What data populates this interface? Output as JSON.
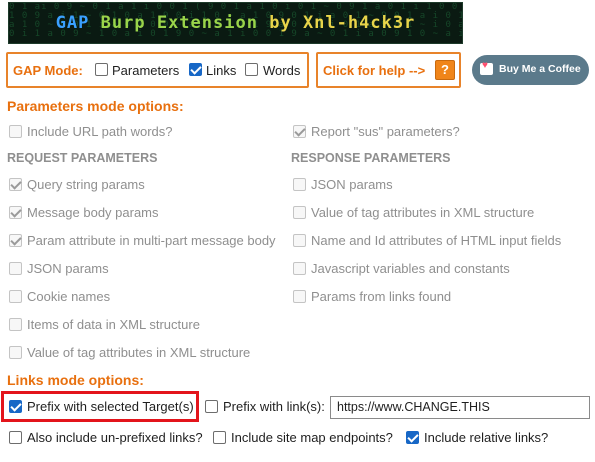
{
  "banner": {
    "title_gap": "GAP",
    "title_mid": "Burp Extension",
    "title_by": "by",
    "title_author": "Xnl-h4ck3r"
  },
  "mode_bar": {
    "label": "GAP Mode:",
    "options": [
      {
        "label": "Parameters",
        "checked": false
      },
      {
        "label": "Links",
        "checked": true
      },
      {
        "label": "Words",
        "checked": false
      }
    ]
  },
  "help": {
    "label": "Click for help -->",
    "button": "?"
  },
  "coffee": {
    "label": "Buy Me a Coffee",
    "icon": "coffee-cup-heart-icon"
  },
  "params_section": {
    "title": "Parameters mode options:",
    "top_left": {
      "label": "Include URL path words?",
      "checked": false
    },
    "top_right": {
      "label": "Report \"sus\" parameters?",
      "checked": true
    },
    "request_title": "REQUEST PARAMETERS",
    "response_title": "RESPONSE PARAMETERS",
    "request": [
      {
        "label": "Query string params",
        "checked": true
      },
      {
        "label": "Message body params",
        "checked": true
      },
      {
        "label": "Param attribute in multi-part message body",
        "checked": true
      },
      {
        "label": "JSON params",
        "checked": false
      },
      {
        "label": "Cookie names",
        "checked": false
      },
      {
        "label": "Items of data in XML structure",
        "checked": false
      },
      {
        "label": "Value of tag attributes in XML structure",
        "checked": false
      }
    ],
    "response": [
      {
        "label": "JSON params",
        "checked": false
      },
      {
        "label": "Value of tag attributes in XML structure",
        "checked": false
      },
      {
        "label": "Name and Id attributes of HTML input fields",
        "checked": false
      },
      {
        "label": "Javascript variables and constants",
        "checked": false
      },
      {
        "label": "Params from links found",
        "checked": false
      }
    ]
  },
  "links_section": {
    "title": "Links mode options:",
    "prefix_target": {
      "label": "Prefix with selected Target(s)",
      "checked": true
    },
    "prefix_link": {
      "label": "Prefix with link(s):",
      "checked": false
    },
    "prefix_url_value": "https://www.CHANGE.THIS",
    "unprefixed": {
      "label": "Also include un-prefixed links?",
      "checked": false
    },
    "sitemap": {
      "label": "Include site map endpoints?",
      "checked": false
    },
    "relative": {
      "label": "Include relative links?",
      "checked": true
    }
  },
  "colors": {
    "accent_orange": "#e8700f",
    "checkbox_blue": "#1767c6",
    "highlight_red": "#e3141b",
    "coffee_button": "#5b7a8b"
  }
}
